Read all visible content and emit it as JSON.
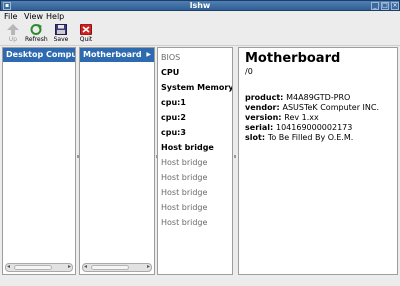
{
  "window": {
    "title": "lshw"
  },
  "menubar": {
    "items": [
      "File",
      "View",
      "Help"
    ]
  },
  "toolbar": {
    "up_label": "Up",
    "refresh_label": "Refresh",
    "save_label": "Save",
    "quit_label": "Quit"
  },
  "columns": {
    "col1_header": "Desktop Computer",
    "col2_header": "Motherboard",
    "col3_items": [
      {
        "label": "BIOS",
        "bold": false
      },
      {
        "label": "CPU",
        "bold": true
      },
      {
        "label": "System Memory",
        "bold": true
      },
      {
        "label": "cpu:1",
        "bold": true
      },
      {
        "label": "cpu:2",
        "bold": true
      },
      {
        "label": "cpu:3",
        "bold": true
      },
      {
        "label": "Host bridge",
        "bold": true
      },
      {
        "label": "Host bridge",
        "bold": false
      },
      {
        "label": "Host bridge",
        "bold": false
      },
      {
        "label": "Host bridge",
        "bold": false
      },
      {
        "label": "Host bridge",
        "bold": false
      },
      {
        "label": "Host bridge",
        "bold": false
      }
    ]
  },
  "detail": {
    "title": "Motherboard",
    "path": "/0",
    "props": [
      {
        "key": "product",
        "value": "M4A89GTD-PRO"
      },
      {
        "key": "vendor",
        "value": "ASUSTeK Computer INC."
      },
      {
        "key": "version",
        "value": "Rev 1.xx"
      },
      {
        "key": "serial",
        "value": "104169000002173"
      },
      {
        "key": "slot",
        "value": "To Be Filled By O.E.M."
      }
    ]
  },
  "colors": {
    "selection": "#2d6ab0",
    "titlebar": "#2f5f95"
  }
}
